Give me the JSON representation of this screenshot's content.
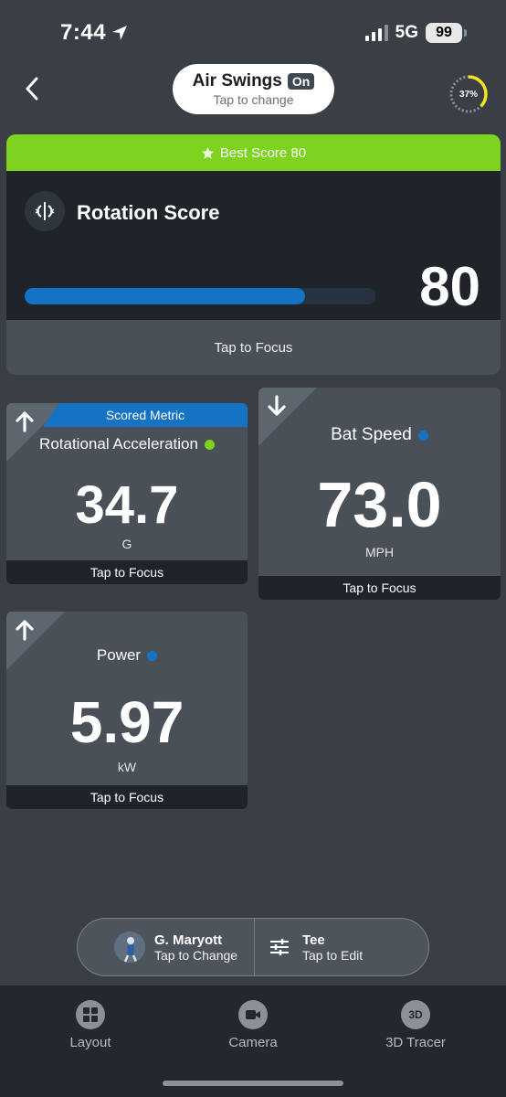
{
  "status_bar": {
    "time": "7:44",
    "network": "5G",
    "battery": "99"
  },
  "header": {
    "mode_title": "Air Swings",
    "mode_badge": "On",
    "mode_subtitle": "Tap to change",
    "progress_label": "37%",
    "progress_value": 0.37
  },
  "score_card": {
    "best_label": "Best Score 80",
    "title": "Rotation Score",
    "value": "80",
    "bar_fraction": 0.8,
    "focus_label": "Tap to Focus"
  },
  "metrics": [
    {
      "name": "Rotational Acceleration",
      "value": "34.7",
      "unit": "G",
      "dot_color": "#7ed321",
      "arrow": "up",
      "ribbon": "Scored Metric",
      "focus": "Tap to Focus"
    },
    {
      "name": "Bat Speed",
      "value": "73.0",
      "unit": "MPH",
      "dot_color": "#1573c5",
      "arrow": "down",
      "focus": "Tap to Focus"
    },
    {
      "name": "Power",
      "value": "5.97",
      "unit": "kW",
      "dot_color": "#1573c5",
      "arrow": "up",
      "focus": "Tap to Focus"
    }
  ],
  "selector": {
    "player_name": "G. Maryott",
    "player_action": "Tap to Change",
    "setup_name": "Tee",
    "setup_action": "Tap to Edit"
  },
  "nav": {
    "items": [
      {
        "label": "Layout",
        "icon": "layout-icon"
      },
      {
        "label": "Camera",
        "icon": "camera-icon"
      },
      {
        "label": "3D Tracer",
        "icon": "3d-icon",
        "icon_text": "3D"
      }
    ]
  },
  "colors": {
    "accent_blue": "#1573c5",
    "accent_green": "#7ed321",
    "background": "#3a3f46"
  }
}
